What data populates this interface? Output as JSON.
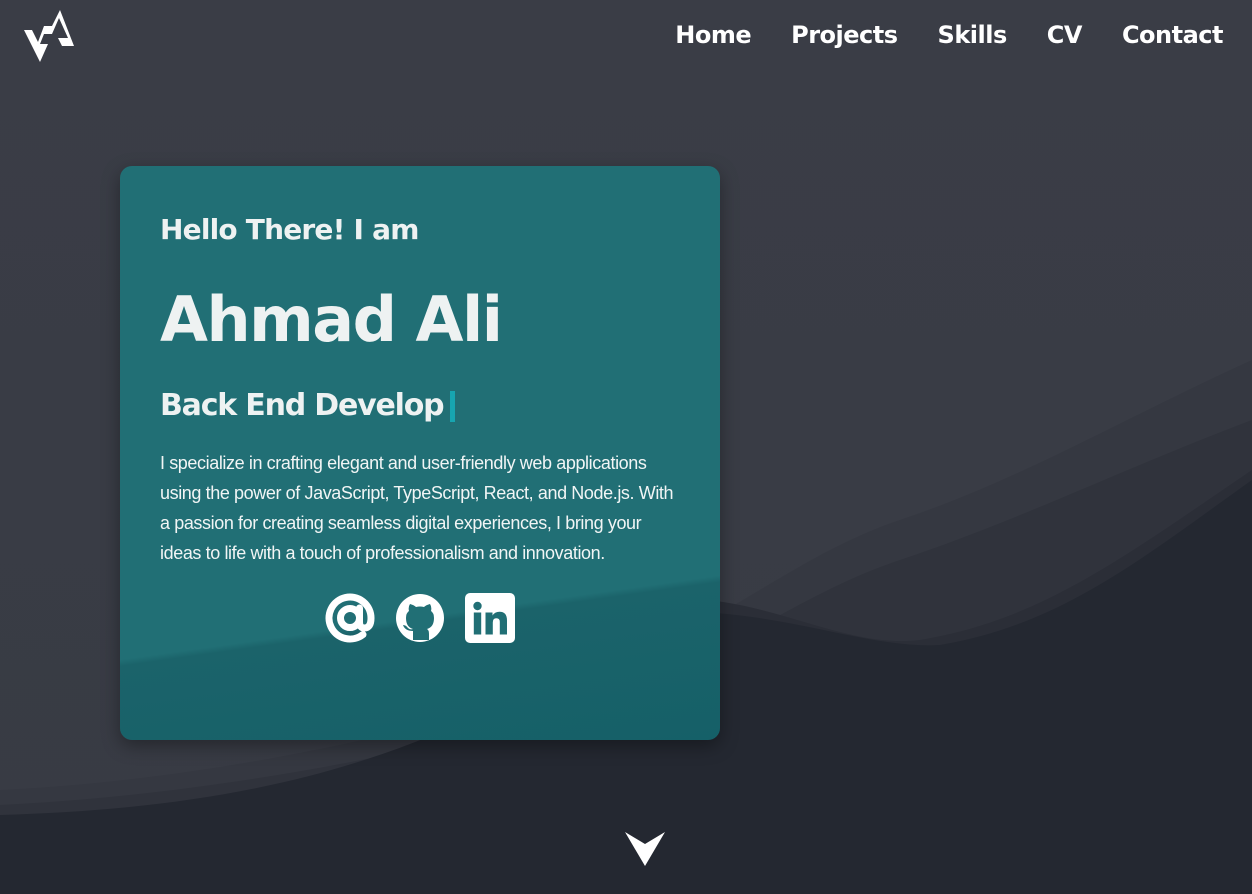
{
  "brand": {
    "logo_icon": "va-monogram-logo-icon"
  },
  "nav": {
    "items": [
      {
        "label": "Home"
      },
      {
        "label": "Projects"
      },
      {
        "label": "Skills"
      },
      {
        "label": "CV"
      },
      {
        "label": "Contact"
      }
    ]
  },
  "hero": {
    "greeting": "Hello There! I am",
    "name": "Ahmad Ali",
    "role": "Back End Develop",
    "description": "I specialize in crafting elegant and user-friendly web applications using the power of JavaScript, TypeScript, React, and Node.js. With a passion for creating seamless digital experiences, I bring your ideas to life with a touch of professionalism and innovation.",
    "socials": [
      {
        "icon": "email-at-icon"
      },
      {
        "icon": "github-icon"
      },
      {
        "icon": "linkedin-icon"
      }
    ],
    "scroll_icon": "arrow-down-icon"
  },
  "colors": {
    "background": "#3a3d46",
    "background_dark": "#22262f",
    "card": "#216f75",
    "cursor_accent": "#17a5b0",
    "text": "#ffffff"
  }
}
